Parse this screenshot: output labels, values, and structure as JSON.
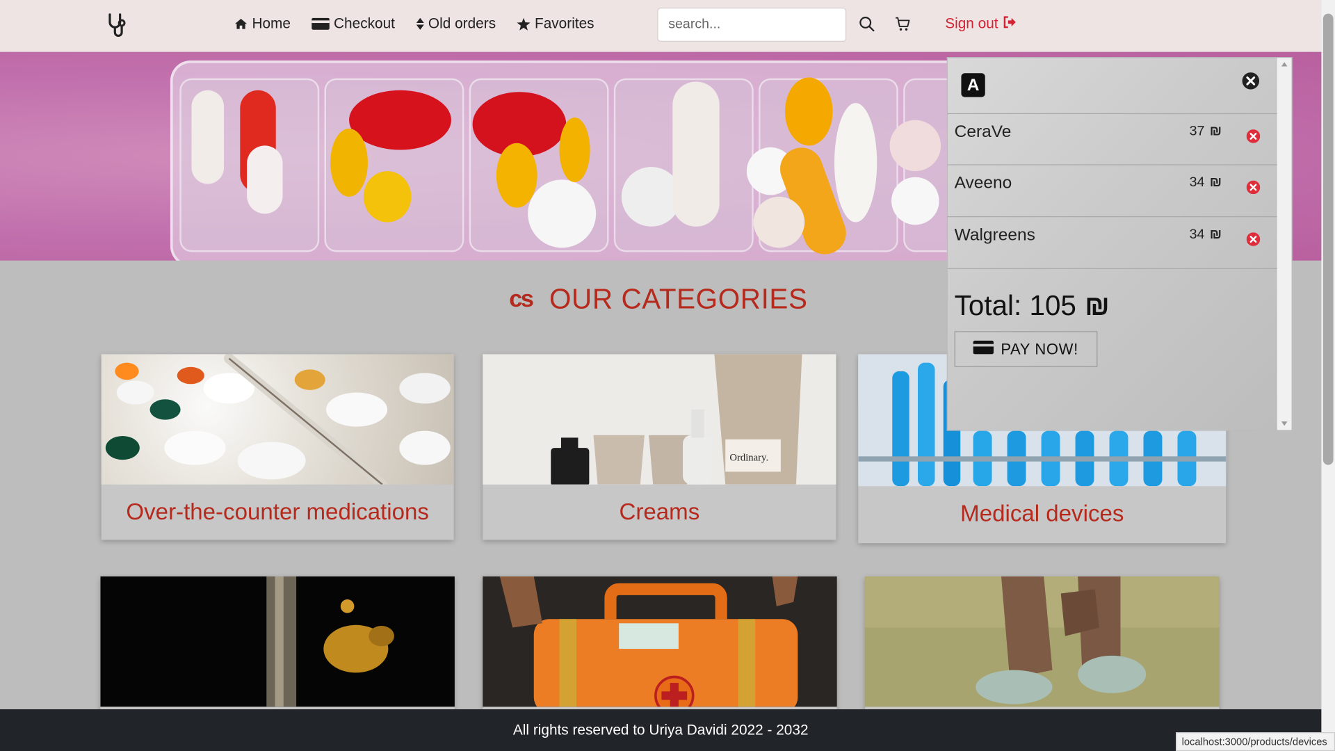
{
  "nav": {
    "home": "Home",
    "checkout": "Checkout",
    "old_orders": "Old orders",
    "favorites": "Favorites",
    "search_placeholder": "search...",
    "sign_out": "Sign out"
  },
  "categories": {
    "title": "OUR CATEGORIES",
    "items": [
      {
        "label": "Over-the-counter medications"
      },
      {
        "label": "Creams"
      },
      {
        "label": "Medical devices"
      },
      {
        "label": ""
      },
      {
        "label": ""
      },
      {
        "label": ""
      }
    ]
  },
  "cart": {
    "items": [
      {
        "name": "CeraVe",
        "price": "37"
      },
      {
        "name": "Aveeno",
        "price": "34"
      },
      {
        "name": "Walgreens",
        "price": "34"
      }
    ],
    "total_label": "Total: 105",
    "currency": "₪",
    "pay_label": "PAY NOW!"
  },
  "footer": {
    "text": "All rights reserved to Uriya Davidi 2022 - 2032"
  },
  "status_bar": {
    "url": "localhost:3000/products/devices"
  },
  "colors": {
    "accent": "#b52a1d",
    "signout": "#d32233",
    "navbar_bg": "#efe4e4",
    "footer_bg": "#212529"
  },
  "icons": [
    "stethoscope-icon",
    "home-icon",
    "credit-card-icon",
    "sort-icon",
    "star-icon",
    "search-icon",
    "cart-icon",
    "sign-out-icon",
    "close-circle-icon",
    "remove-icon",
    "shekel-icon"
  ]
}
